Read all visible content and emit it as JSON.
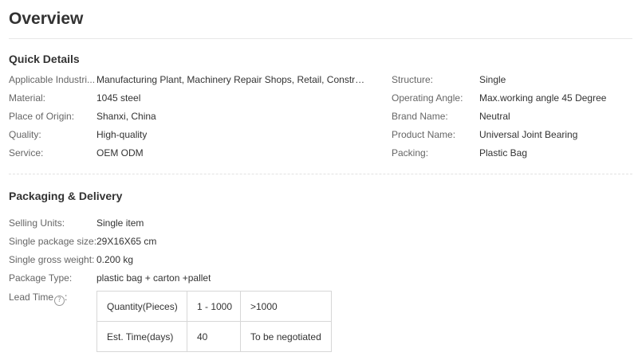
{
  "overview": {
    "title": "Overview"
  },
  "quick_details": {
    "title": "Quick Details",
    "left": [
      {
        "label": "Applicable Industri...",
        "value": "Manufacturing Plant, Machinery Repair Shops, Retail, Constru..."
      },
      {
        "label": "Material:",
        "value": "1045 steel"
      },
      {
        "label": "Place of Origin:",
        "value": "Shanxi, China"
      },
      {
        "label": "Quality:",
        "value": "High-quality"
      },
      {
        "label": "Service:",
        "value": "OEM ODM"
      }
    ],
    "right": [
      {
        "label": "Structure:",
        "value": "Single"
      },
      {
        "label": "Operating Angle:",
        "value": "Max.working angle 45 Degree"
      },
      {
        "label": "Brand Name:",
        "value": "Neutral"
      },
      {
        "label": "Product Name:",
        "value": "Universal Joint Bearing"
      },
      {
        "label": "Packing:",
        "value": "Plastic Bag"
      }
    ]
  },
  "packaging": {
    "title": "Packaging & Delivery",
    "rows": [
      {
        "label": "Selling Units:",
        "value": "Single item"
      },
      {
        "label": "Single package size:",
        "value": "29X16X65 cm"
      },
      {
        "label": "Single gross weight:",
        "value": "0.200 kg"
      },
      {
        "label": "Package Type:",
        "value": "plastic bag + carton +pallet"
      }
    ],
    "lead_time": {
      "label": "Lead Time",
      "help_icon": "?",
      "table": [
        [
          "Quantity(Pieces)",
          "1 - 1000",
          ">1000"
        ],
        [
          "Est. Time(days)",
          "40",
          "To be negotiated"
        ]
      ]
    }
  }
}
